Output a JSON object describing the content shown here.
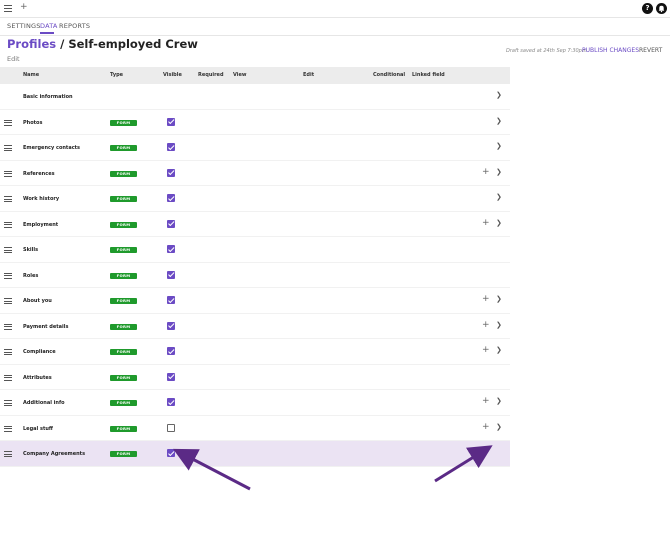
{
  "topbar": {
    "add_label": "+",
    "help_label": "?",
    "notify_label": ""
  },
  "tabs": [
    {
      "label": "SETTINGS",
      "active": false
    },
    {
      "label": "DATA",
      "active": true
    },
    {
      "label": "REPORTS",
      "active": false
    }
  ],
  "page": {
    "breadcrumb": "Profiles",
    "separator": " / ",
    "title": "Self-employed Crew",
    "edit_label": "Edit",
    "draft_status": "Draft saved at 24th Sep 7:30pm",
    "publish_label": "PUBLISH CHANGES",
    "revert_label": "REVERT"
  },
  "table": {
    "columns": [
      "Name",
      "Type",
      "Visible",
      "Required",
      "View",
      "Edit",
      "Conditional",
      "Linked field"
    ],
    "rows": [
      {
        "name": "Basic information",
        "type": "",
        "visible": null,
        "add": false,
        "chevron": true,
        "drag": false
      },
      {
        "name": "Photos",
        "type": "FORM",
        "visible": true,
        "add": false,
        "chevron": true,
        "drag": true
      },
      {
        "name": "Emergency contacts",
        "type": "FORM",
        "visible": true,
        "add": false,
        "chevron": true,
        "drag": true
      },
      {
        "name": "References",
        "type": "FORM",
        "visible": true,
        "add": true,
        "chevron": true,
        "drag": true
      },
      {
        "name": "Work history",
        "type": "FORM",
        "visible": true,
        "add": false,
        "chevron": true,
        "drag": true
      },
      {
        "name": "Employment",
        "type": "FORM",
        "visible": true,
        "add": true,
        "chevron": true,
        "drag": true
      },
      {
        "name": "Skills",
        "type": "FORM",
        "visible": true,
        "add": false,
        "chevron": false,
        "drag": true
      },
      {
        "name": "Roles",
        "type": "FORM",
        "visible": true,
        "add": false,
        "chevron": false,
        "drag": true
      },
      {
        "name": "About you",
        "type": "FORM",
        "visible": true,
        "add": true,
        "chevron": true,
        "drag": true
      },
      {
        "name": "Payment details",
        "type": "FORM",
        "visible": true,
        "add": true,
        "chevron": true,
        "drag": true
      },
      {
        "name": "Compliance",
        "type": "FORM",
        "visible": true,
        "add": true,
        "chevron": true,
        "drag": true
      },
      {
        "name": "Attributes",
        "type": "FORM",
        "visible": true,
        "add": false,
        "chevron": false,
        "drag": true
      },
      {
        "name": "Additional info",
        "type": "FORM",
        "visible": true,
        "add": true,
        "chevron": true,
        "drag": true
      },
      {
        "name": "Legal stuff",
        "type": "FORM",
        "visible": false,
        "add": true,
        "chevron": true,
        "drag": true
      },
      {
        "name": "Company Agreements",
        "type": "FORM",
        "visible": true,
        "add": true,
        "chevron": false,
        "drag": true,
        "highlight": true
      }
    ]
  },
  "colors": {
    "accent": "#6b4bc4",
    "badge": "#1f9a2c",
    "highlight": "#ebe3f3",
    "arrow": "#5b2a86"
  },
  "icons": {
    "menu": "hamburger-icon",
    "drag": "drag-handle-icon",
    "add": "plus-icon",
    "chevron": "chevron-right-icon",
    "help": "help-icon",
    "notify": "bell-icon"
  }
}
